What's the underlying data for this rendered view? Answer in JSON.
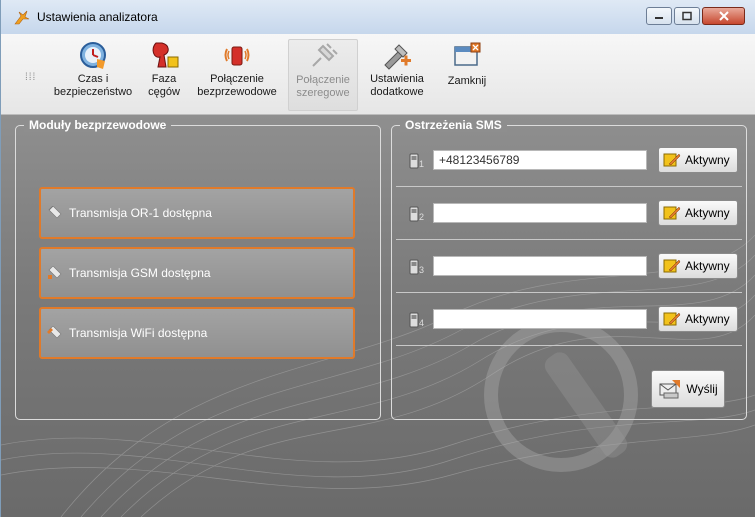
{
  "window": {
    "title": "Ustawienia analizatora"
  },
  "toolbar": {
    "grip": "⁞⁞⁞",
    "buttons": [
      {
        "label": "Czas i\nbezpieczeństwo",
        "icon": "clock-shield-icon"
      },
      {
        "label": "Faza\ncęgów",
        "icon": "clamp-phase-icon"
      },
      {
        "label": "Połączenie\nbezprzewodowe",
        "icon": "wireless-icon"
      },
      {
        "label": "Połączenie\nszeregowe",
        "icon": "serial-plug-icon",
        "disabled": true
      },
      {
        "label": "Ustawienia\ndodatkowe",
        "icon": "tools-icon"
      },
      {
        "label": "Zamknij",
        "icon": "close-window-icon"
      }
    ]
  },
  "modules": {
    "title": "Moduły bezprzewodowe",
    "items": [
      {
        "label": "Transmisja OR-1 dostępna",
        "icon": "or1-module-icon"
      },
      {
        "label": "Transmisja GSM dostępna",
        "icon": "gsm-module-icon"
      },
      {
        "label": "Transmisja WiFi dostępna",
        "icon": "wifi-module-icon"
      }
    ]
  },
  "sms": {
    "title": "Ostrzeżenia SMS",
    "rows": [
      {
        "index": "1",
        "value": "+48123456789",
        "button": "Aktywny"
      },
      {
        "index": "2",
        "value": "",
        "button": "Aktywny"
      },
      {
        "index": "3",
        "value": "",
        "button": "Aktywny"
      },
      {
        "index": "4",
        "value": "",
        "button": "Aktywny"
      }
    ],
    "send_label": "Wyślij"
  },
  "colors": {
    "accent": "#e07a2a",
    "title_bar": "#c6d7ec",
    "close_button": "#c7482f"
  }
}
